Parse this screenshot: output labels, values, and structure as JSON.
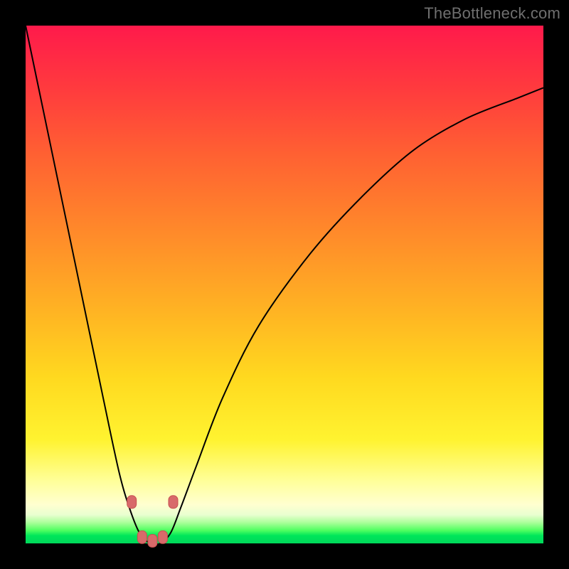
{
  "watermark": "TheBottleneck.com",
  "colors": {
    "frame": "#000000",
    "gradient_top": "#ff1a4b",
    "gradient_mid": "#ffd91f",
    "gradient_bottom": "#00d85a",
    "curve": "#000000",
    "node_fill": "#d86a6a"
  },
  "chart_data": {
    "type": "line",
    "title": "",
    "xlabel": "",
    "ylabel": "",
    "xlim": [
      0,
      100
    ],
    "ylim": [
      0,
      100
    ],
    "grid": false,
    "legend": false,
    "series": [
      {
        "name": "bottleneck-curve",
        "x": [
          0,
          5,
          10,
          15,
          18,
          20,
          22,
          24,
          25,
          26,
          28,
          30,
          33,
          38,
          45,
          55,
          65,
          75,
          85,
          95,
          100
        ],
        "values": [
          100,
          76,
          52,
          28,
          14,
          7,
          2,
          0,
          0,
          0,
          2,
          7,
          15,
          28,
          42,
          56,
          67,
          76,
          82,
          86,
          88
        ]
      }
    ],
    "nodes": [
      {
        "x": 20.5,
        "y": 8
      },
      {
        "x": 28.5,
        "y": 8
      },
      {
        "x": 22.5,
        "y": 1.2
      },
      {
        "x": 24.5,
        "y": 0.5
      },
      {
        "x": 26.5,
        "y": 1.2
      }
    ],
    "notes": "V-shaped curve with minimum near x≈25% reaching y≈0; left branch steeper than right; right branch asymptotes near y≈88 at x=100. Background is a vertical heat gradient (red top → green bottom). No axis ticks or labels visible."
  }
}
